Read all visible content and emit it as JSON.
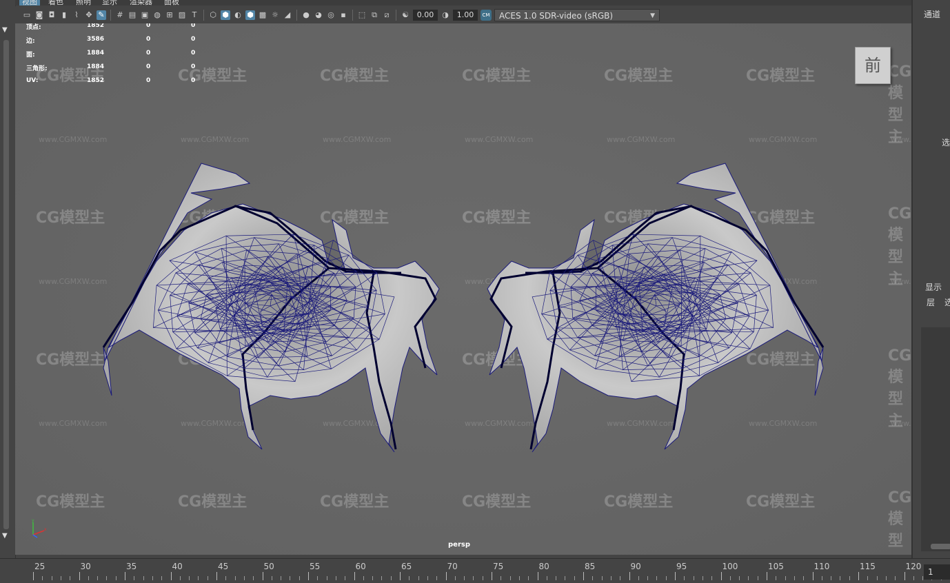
{
  "menubar": {
    "items": [
      {
        "label": "视图",
        "active": true
      },
      {
        "label": "着色",
        "active": false
      },
      {
        "label": "照明",
        "active": false
      },
      {
        "label": "显示",
        "active": false
      },
      {
        "label": "渲染器",
        "active": false
      },
      {
        "label": "面板",
        "active": false
      }
    ]
  },
  "toolbar": {
    "exposure_value": "0.00",
    "gamma_value": "1.00",
    "color_management_badge": "CM",
    "color_space": "ACES 1.0 SDR-video (sRGB)",
    "icons": [
      "camera-select-icon",
      "camera-attr-icon",
      "bookmark-icon",
      "image-plane-icon",
      "grid-icon",
      "film-gate-icon",
      "resolution-gate-icon",
      "gate-mask-icon",
      "field-chart-icon",
      "safe-action-icon",
      "safe-title-icon",
      "wireframe-icon",
      "smooth-shade-icon",
      "default-material-icon",
      "wireframe-on-shaded-icon",
      "xray-icon",
      "lights-icon",
      "shadows-icon",
      "ambient-occlusion-icon",
      "motion-blur-icon",
      "anti-alias-icon",
      "depth-of-field-icon",
      "isolate-select-icon",
      "xray-joints-icon",
      "xray-active-icon",
      "exposure-icon",
      "gamma-icon"
    ]
  },
  "hud": {
    "rows": [
      {
        "label": "顶点:",
        "v1": "1852",
        "v2": "0",
        "v3": "0"
      },
      {
        "label": "边:",
        "v1": "3586",
        "v2": "0",
        "v3": "0"
      },
      {
        "label": "面:",
        "v1": "1884",
        "v2": "0",
        "v3": "0"
      },
      {
        "label": "三角形:",
        "v1": "1884",
        "v2": "0",
        "v3": "0"
      },
      {
        "label": "UV:",
        "v1": "1852",
        "v2": "0",
        "v3": "0"
      }
    ]
  },
  "viewcube": {
    "face_label": "前"
  },
  "viewport": {
    "camera_label": "persp",
    "watermark_text": "CG模型主",
    "watermark_url": "www.CGMXW.com"
  },
  "right_panel": {
    "title": "通道",
    "frag_select": "选",
    "frag_display": "显示",
    "frag_layer": "层",
    "frag_select2": "选"
  },
  "timeline": {
    "labels": [
      "25",
      "30",
      "35",
      "40",
      "45",
      "50",
      "55",
      "60",
      "65",
      "70",
      "75",
      "80",
      "85",
      "90",
      "95",
      "100",
      "105",
      "110",
      "115",
      "120"
    ],
    "current_frame": "1"
  },
  "colors": {
    "viewport_bg": "#676767",
    "wire": "#1a1a7a",
    "mesh_fill": "#c8c8c8",
    "accent": "#5285a6"
  }
}
